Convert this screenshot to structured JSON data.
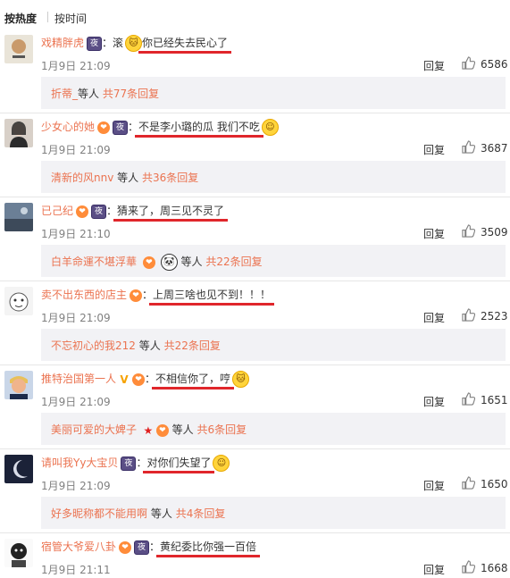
{
  "tabs": [
    "按热度",
    "按时间"
  ],
  "comments": [
    {
      "user": "戏精胖虎",
      "text": "滚",
      "text2": "你已经失去民心了",
      "time": "1月9日 21:09",
      "reply_label": "回复",
      "likes": "6586",
      "sub": {
        "names": "折蒂_",
        "mid": "等人",
        "count": "共77条回复"
      }
    },
    {
      "user": "少女心的她",
      "text": "不是李小璐的瓜 我们不吃",
      "time": "1月9日 21:09",
      "reply_label": "回复",
      "likes": "3687",
      "sub": {
        "names": "清新的风nnv",
        "mid": "等人",
        "count": "共36条回复"
      }
    },
    {
      "user": "已己纪",
      "text": "猜来了，周三见不灵了",
      "time": "1月9日 21:10",
      "reply_label": "回复",
      "likes": "3509",
      "sub": {
        "names": "白羊命運不堪浮華",
        "mid": "等人",
        "count": "共22条回复"
      }
    },
    {
      "user": "卖不出东西的店主",
      "text": "上周三啥也见不到！！！",
      "time": "1月9日 21:09",
      "reply_label": "回复",
      "likes": "2523",
      "sub": {
        "names": "不忘初心的我212",
        "mid": "等人",
        "count": "共22条回复"
      }
    },
    {
      "user": "推特治国第一人",
      "text": "不相信你了，哼",
      "time": "1月9日 21:09",
      "reply_label": "回复",
      "likes": "1651",
      "sub": {
        "names": "美丽可爱的大婢子",
        "mid": "等人",
        "count": "共6条回复"
      }
    },
    {
      "user": "请叫我Yy大宝贝",
      "text": "对你们失望了",
      "time": "1月9日 21:09",
      "reply_label": "回复",
      "likes": "1650",
      "sub": {
        "names": "好多昵称都不能用啊",
        "mid": "等人",
        "count": "共4条回复"
      }
    },
    {
      "user": "宿管大爷爱八卦",
      "text": "黄纪委比你强一百倍",
      "time": "1月9日 21:11",
      "reply_label": "回复",
      "likes": "1668"
    }
  ],
  "badge_labels": {
    "night": "夜",
    "vip": "V",
    "heart": "❤"
  },
  "colors": {
    "username": "#eb7350",
    "underline": "#e0262b",
    "subbox_bg": "#f2f2f5"
  }
}
